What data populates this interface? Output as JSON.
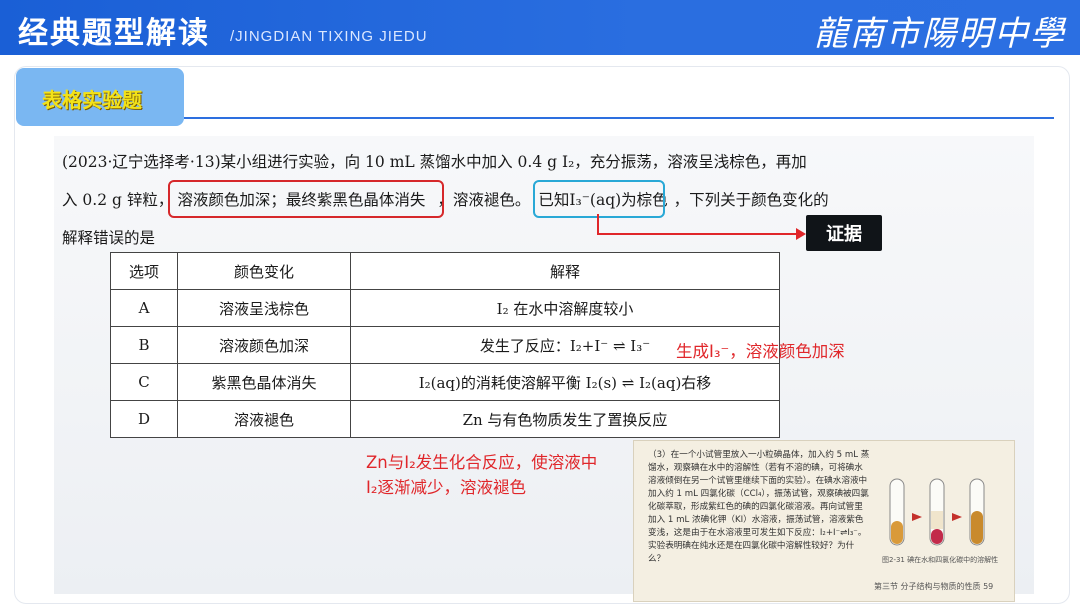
{
  "header": {
    "title": "经典题型解读",
    "subtitle": "/JINGDIAN TIXING JIEDU",
    "school": "龍南市陽明中學"
  },
  "section_tag": "表格实验题",
  "question": {
    "line1": "(2023·辽宁选择考·13)某小组进行实验，向 10 mL 蒸馏水中加入 0.4 g I₂，充分振荡，溶液呈浅棕色，再加",
    "line2_a": "入 0.2 g 锌粒，",
    "line2_b": "溶液颜色加深；最终紫黑色晶体消失",
    "line2_c": "，溶液褪色。",
    "line2_d": "已知I₃⁻(aq)为棕色",
    "line2_e": "，下列关于颜色变化的",
    "line3": "解释错误的是"
  },
  "evidence_label": "证据",
  "table": {
    "headers": [
      "选项",
      "颜色变化",
      "解释"
    ],
    "rows": [
      [
        "A",
        "溶液呈浅棕色",
        "I₂ 在水中溶解度较小"
      ],
      [
        "B",
        "溶液颜色加深",
        "发生了反应：I₂+I⁻ ⇌ I₃⁻"
      ],
      [
        "C",
        "紫黑色晶体消失",
        "I₂(aq)的消耗使溶解平衡 I₂(s) ⇌ I₂(aq)右移"
      ],
      [
        "D",
        "溶液褪色",
        "Zn 与有色物质发生了置换反应"
      ]
    ]
  },
  "annotations": {
    "note_b": "生成I₃⁻，溶液颜色加深",
    "note_d_line1": "Zn与I₂发生化合反应，使溶液中",
    "note_d_line2": "I₂逐渐减少，溶液褪色"
  },
  "textbook": {
    "paragraph": "（3）在一个小试管里放入一小粒碘晶体，加入约 5 mL 蒸馏水，观察碘在水中的溶解性（若有不溶的碘，可将碘水溶液倾倒在另一个试管里继续下面的实验）。在碘水溶液中加入约 1 mL 四氯化碳（CCl₄），振荡试管，观察碘被四氯化碳萃取，形成紫红色的碘的四氯化碳溶液。再向试管里加入 1 mL 浓碘化钾（KI）水溶液，振荡试管，溶液紫色变浅，这是由于在水溶液里可发生如下反应：I₂+I⁻⇌I₃⁻。实验表明碘在纯水还是在四氯化碳中溶解性较好？为什么？",
    "figure_caption": "图2-31 碘在水和四氯化碳中的溶解性",
    "footer": "第三节 分子结构与物质的性质   59"
  }
}
